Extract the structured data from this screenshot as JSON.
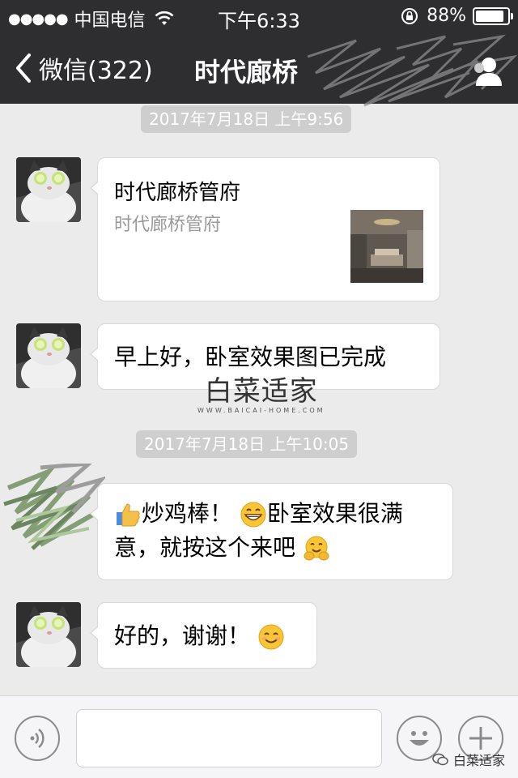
{
  "status_bar": {
    "signal": "●●●●●",
    "carrier": "中国电信",
    "time": "下午6:33",
    "battery": "88%"
  },
  "nav": {
    "back_label": "微信(322)",
    "title": "时代廊桥",
    "back_icon": "chevron-left-icon",
    "contact_icon": "person-icon"
  },
  "messages": {
    "timestamp_1": "2017年7月18日 上午9:56",
    "link_card": {
      "title": "时代廊桥管府",
      "description": "时代廊桥管府"
    },
    "msg_2": "早上好，卧室效果图已完成",
    "timestamp_2": "2017年7月18日 上午10:05",
    "msg_3_part_1": "炒鸡棒！",
    "msg_3_part_2": "卧室效果很满意，就按这个来吧",
    "msg_4": "好的，谢谢！"
  },
  "watermark": {
    "main": "白菜适家",
    "sub": "WWW.BAICAI-HOME.COM"
  },
  "input_bar": {
    "credit": "白菜适家"
  },
  "colors": {
    "nav_bg": "#2e2e30",
    "chat_bg": "#ebebeb",
    "timestamp_bg": "#cecece",
    "bubble_bg": "#ffffff"
  }
}
